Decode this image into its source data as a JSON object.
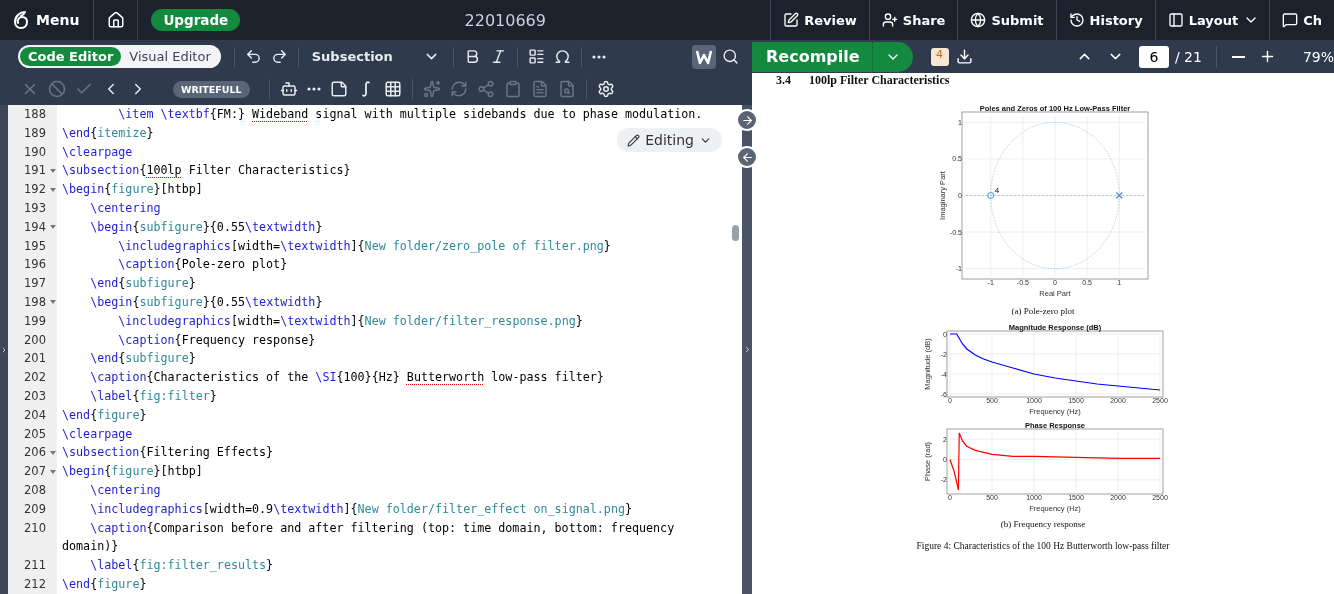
{
  "top_bar": {
    "menu": "Menu",
    "upgrade": "Upgrade",
    "title": "22010669",
    "actions": [
      {
        "label": "Review",
        "dropdown": false
      },
      {
        "label": "Share",
        "dropdown": false
      },
      {
        "label": "Submit",
        "dropdown": false
      },
      {
        "label": "History",
        "dropdown": false
      },
      {
        "label": "Layout",
        "dropdown": true
      },
      {
        "label": "Ch",
        "dropdown": false
      }
    ]
  },
  "editor_toolbar": {
    "modes": [
      {
        "label": "Code Editor",
        "selected": true
      },
      {
        "label": "Visual Editor",
        "selected": false
      }
    ],
    "style_menu": "Subsection",
    "writefull_toggle": {
      "selected": true
    },
    "writefull": "WRITEFULL",
    "review_tools": [
      {
        "disabled": true
      },
      {
        "disabled": true
      },
      {
        "disabled": true
      },
      {
        "disabled": false
      },
      {
        "disabled": false
      }
    ],
    "assist_tools": [
      {
        "disabled": false
      },
      {
        "disabled": false
      },
      {
        "disabled": false
      },
      {
        "disabled": false
      },
      {
        "disabled": false
      }
    ],
    "ai_tools": [
      {
        "disabled": true
      },
      {
        "disabled": true
      },
      {
        "disabled": true
      },
      {
        "disabled": true
      },
      {
        "disabled": true
      },
      {
        "disabled": true
      }
    ]
  },
  "pdf_toolbar": {
    "recompile": "Recompile",
    "log_badge": "4",
    "page": "6",
    "page_total": "/ 21",
    "zoom": "79%"
  },
  "editing_menu": "Editing",
  "code": {
    "lines": [
      {
        "number": "188",
        "fold": false,
        "tokens": [
          {
            "kind": "cmd",
            "text": "        \\item \\textbf"
          },
          {
            "kind": "text",
            "text": "{FM:} "
          },
          {
            "kind": "typo",
            "text": "Wideband"
          },
          {
            "kind": "text",
            "text": " signal with multiple sidebands due to phase modulation."
          }
        ]
      },
      {
        "number": "189",
        "fold": false,
        "tokens": [
          {
            "kind": "cmd",
            "text": "\\end"
          },
          {
            "kind": "text",
            "text": "{"
          },
          {
            "kind": "name",
            "text": "itemize"
          },
          {
            "kind": "text",
            "text": "}"
          }
        ]
      },
      {
        "number": "190",
        "fold": false,
        "tokens": [
          {
            "kind": "cmd",
            "text": "\\clearpage"
          }
        ]
      },
      {
        "number": "191",
        "fold": true,
        "tokens": [
          {
            "kind": "cmd",
            "text": "\\subsection"
          },
          {
            "kind": "text",
            "text": "{"
          },
          {
            "kind": "typo",
            "text": "100lp"
          },
          {
            "kind": "text",
            "text": " Filter Characteristics}"
          }
        ]
      },
      {
        "number": "192",
        "fold": true,
        "tokens": [
          {
            "kind": "cmd",
            "text": "\\begin"
          },
          {
            "kind": "text",
            "text": "{"
          },
          {
            "kind": "name",
            "text": "figure"
          },
          {
            "kind": "text",
            "text": "}[htbp]"
          }
        ]
      },
      {
        "number": "193",
        "fold": false,
        "tokens": [
          {
            "kind": "cmd",
            "text": "    \\centering"
          }
        ]
      },
      {
        "number": "194",
        "fold": true,
        "tokens": [
          {
            "kind": "cmd",
            "text": "    \\begin"
          },
          {
            "kind": "text",
            "text": "{"
          },
          {
            "kind": "name",
            "text": "subfigure"
          },
          {
            "kind": "text",
            "text": "}{0.55"
          },
          {
            "kind": "cmd",
            "text": "\\textwidth"
          },
          {
            "kind": "text",
            "text": "}"
          }
        ]
      },
      {
        "number": "195",
        "fold": false,
        "tokens": [
          {
            "kind": "cmd",
            "text": "        \\includegraphics"
          },
          {
            "kind": "text",
            "text": "[width="
          },
          {
            "kind": "cmd",
            "text": "\\textwidth"
          },
          {
            "kind": "text",
            "text": "]{"
          },
          {
            "kind": "name",
            "text": "New folder/zero_pole of filter.png"
          },
          {
            "kind": "text",
            "text": "}"
          }
        ]
      },
      {
        "number": "196",
        "fold": false,
        "tokens": [
          {
            "kind": "cmd",
            "text": "        \\caption"
          },
          {
            "kind": "text",
            "text": "{Pole-zero plot}"
          }
        ]
      },
      {
        "number": "197",
        "fold": false,
        "tokens": [
          {
            "kind": "cmd",
            "text": "    \\end"
          },
          {
            "kind": "text",
            "text": "{"
          },
          {
            "kind": "name",
            "text": "subfigure"
          },
          {
            "kind": "text",
            "text": "}"
          }
        ]
      },
      {
        "number": "198",
        "fold": true,
        "tokens": [
          {
            "kind": "cmd",
            "text": "    \\begin"
          },
          {
            "kind": "text",
            "text": "{"
          },
          {
            "kind": "name",
            "text": "subfigure"
          },
          {
            "kind": "text",
            "text": "}{0.55"
          },
          {
            "kind": "cmd",
            "text": "\\textwidth"
          },
          {
            "kind": "text",
            "text": "}"
          }
        ]
      },
      {
        "number": "199",
        "fold": false,
        "tokens": [
          {
            "kind": "cmd",
            "text": "        \\includegraphics"
          },
          {
            "kind": "text",
            "text": "[width="
          },
          {
            "kind": "cmd",
            "text": "\\textwidth"
          },
          {
            "kind": "text",
            "text": "]{"
          },
          {
            "kind": "name",
            "text": "New folder/filter_response.png"
          },
          {
            "kind": "text",
            "text": "}"
          }
        ]
      },
      {
        "number": "200",
        "fold": false,
        "tokens": [
          {
            "kind": "cmd",
            "text": "        \\caption"
          },
          {
            "kind": "text",
            "text": "{Frequency response}"
          }
        ]
      },
      {
        "number": "201",
        "fold": false,
        "tokens": [
          {
            "kind": "cmd",
            "text": "    \\end"
          },
          {
            "kind": "text",
            "text": "{"
          },
          {
            "kind": "name",
            "text": "subfigure"
          },
          {
            "kind": "text",
            "text": "}"
          }
        ]
      },
      {
        "number": "202",
        "fold": false,
        "tokens": [
          {
            "kind": "cmd",
            "text": "    \\caption"
          },
          {
            "kind": "text",
            "text": "{Characteristics of the "
          },
          {
            "kind": "cmd",
            "text": "\\SI"
          },
          {
            "kind": "text",
            "text": "{100}{Hz} "
          },
          {
            "kind": "typo",
            "text": "Butterworth"
          },
          {
            "kind": "text",
            "text": " low-pass filter}"
          }
        ]
      },
      {
        "number": "203",
        "fold": false,
        "tokens": [
          {
            "kind": "cmd",
            "text": "    \\label"
          },
          {
            "kind": "text",
            "text": "{"
          },
          {
            "kind": "name",
            "text": "fig:filter"
          },
          {
            "kind": "text",
            "text": "}"
          }
        ]
      },
      {
        "number": "204",
        "fold": false,
        "tokens": [
          {
            "kind": "cmd",
            "text": "\\end"
          },
          {
            "kind": "text",
            "text": "{"
          },
          {
            "kind": "name",
            "text": "figure"
          },
          {
            "kind": "text",
            "text": "}"
          }
        ]
      },
      {
        "number": "205",
        "fold": false,
        "tokens": [
          {
            "kind": "cmd",
            "text": "\\clearpage"
          }
        ]
      },
      {
        "number": "206",
        "fold": true,
        "tokens": [
          {
            "kind": "cmd",
            "text": "\\subsection"
          },
          {
            "kind": "text",
            "text": "{Filtering Effects}"
          }
        ]
      },
      {
        "number": "207",
        "fold": true,
        "tokens": [
          {
            "kind": "cmd",
            "text": "\\begin"
          },
          {
            "kind": "text",
            "text": "{"
          },
          {
            "kind": "name",
            "text": "figure"
          },
          {
            "kind": "text",
            "text": "}[htbp]"
          }
        ]
      },
      {
        "number": "208",
        "fold": false,
        "tokens": [
          {
            "kind": "cmd",
            "text": "    \\centering"
          }
        ]
      },
      {
        "number": "209",
        "fold": false,
        "tokens": [
          {
            "kind": "cmd",
            "text": "    \\includegraphics"
          },
          {
            "kind": "text",
            "text": "[width=0.9"
          },
          {
            "kind": "cmd",
            "text": "\\textwidth"
          },
          {
            "kind": "text",
            "text": "]{"
          },
          {
            "kind": "name",
            "text": "New folder/filter_effect on_signal.png"
          },
          {
            "kind": "text",
            "text": "}"
          }
        ]
      },
      {
        "number": "210",
        "fold": false,
        "tokens": [
          {
            "kind": "cmd",
            "text": "    \\caption"
          },
          {
            "kind": "text",
            "text": "{Comparison before and after filtering (top: time domain, bottom: frequency domain)}"
          }
        ]
      },
      {
        "number": "211",
        "fold": false,
        "tokens": [
          {
            "kind": "cmd",
            "text": "    \\label"
          },
          {
            "kind": "text",
            "text": "{"
          },
          {
            "kind": "name",
            "text": "fig:filter_results"
          },
          {
            "kind": "text",
            "text": "}"
          }
        ]
      },
      {
        "number": "212",
        "fold": false,
        "tokens": [
          {
            "kind": "cmd",
            "text": "\\end"
          },
          {
            "kind": "text",
            "text": "{"
          },
          {
            "kind": "name",
            "text": "figure"
          },
          {
            "kind": "text",
            "text": "}"
          }
        ]
      }
    ]
  },
  "pdf": {
    "section_number": "3.4",
    "section_title": "100lp Filter Characteristics",
    "pole_zero": {
      "caption": "(a) Pole-zero plot",
      "chart_data": {
        "type": "scatter",
        "title": "Poles and Zeros of 100 Hz Low-Pass Filter",
        "xlabel": "Real Part",
        "ylabel": "Imaginary Part",
        "xlim": [
          -1.4,
          1.4
        ],
        "ylim": [
          -1.1,
          1.1
        ],
        "xticks": [
          -1,
          -0.5,
          0,
          0.5,
          1
        ],
        "yticks": [
          -1,
          -0.5,
          0,
          0.5,
          1
        ],
        "grid": true,
        "ref_lines": [
          {
            "axis": "y",
            "value": 0
          }
        ],
        "x": [
          -1,
          1
        ],
        "series": [
          {
            "color": "#4a90d9",
            "marker": "circle",
            "values": [
              0,
              null
            ]
          },
          {
            "color": "#4a90d9",
            "marker": "cross",
            "values": [
              null,
              0
            ]
          }
        ],
        "annotations": [
          {
            "x": -1,
            "y": 0,
            "text": "4"
          }
        ]
      }
    },
    "magnitude": {
      "chart_data": {
        "type": "line",
        "title": "Magnitude Response (dB)",
        "xlabel": "Frequency (Hz)",
        "ylabel": "Magnitude (dB)",
        "xlim": [
          0,
          2500
        ],
        "ylim": [
          -6,
          0
        ],
        "xticks": [
          0,
          500,
          1000,
          1500,
          2000,
          2500
        ],
        "yticks": [
          -6,
          -4,
          -2,
          0
        ],
        "grid": true,
        "x": [
          0,
          50,
          80,
          100,
          150,
          200,
          300,
          400,
          500,
          750,
          1000,
          1250,
          1500,
          1750,
          2000,
          2250,
          2500
        ],
        "series": [
          {
            "color": "#0000ff",
            "values": [
              0,
              0,
              0,
              -0.3,
              -1,
              -1.5,
              -2.1,
              -2.5,
              -2.8,
              -3.4,
              -4,
              -4.4,
              -4.7,
              -5,
              -5.2,
              -5.4,
              -5.6
            ]
          }
        ]
      }
    },
    "phase": {
      "caption": "(b) Frequency response",
      "chart_data": {
        "type": "line",
        "title": "Phase Response",
        "xlabel": "Frequency (Hz)",
        "ylabel": "Phase (rad)",
        "xlim": [
          0,
          2500
        ],
        "ylim": [
          -3.1,
          2.7
        ],
        "xticks": [
          0,
          500,
          1000,
          1500,
          2000,
          2500
        ],
        "yticks": [
          -2,
          0,
          2
        ],
        "grid": true,
        "x": [
          0,
          50,
          100,
          110,
          150,
          200,
          300,
          400,
          500,
          750,
          1000,
          1500,
          2000,
          2500
        ],
        "series": [
          {
            "color": "#ff0000",
            "values": [
              0,
              -1.2,
              -3,
              2.6,
              1.8,
              1.3,
              0.9,
              0.7,
              0.5,
              0.3,
              0.3,
              0.2,
              0.1,
              0.1
            ]
          }
        ]
      }
    },
    "figure_caption": "Figure 4: Characteristics of the 100 Hz Butterworth low-pass filter"
  }
}
